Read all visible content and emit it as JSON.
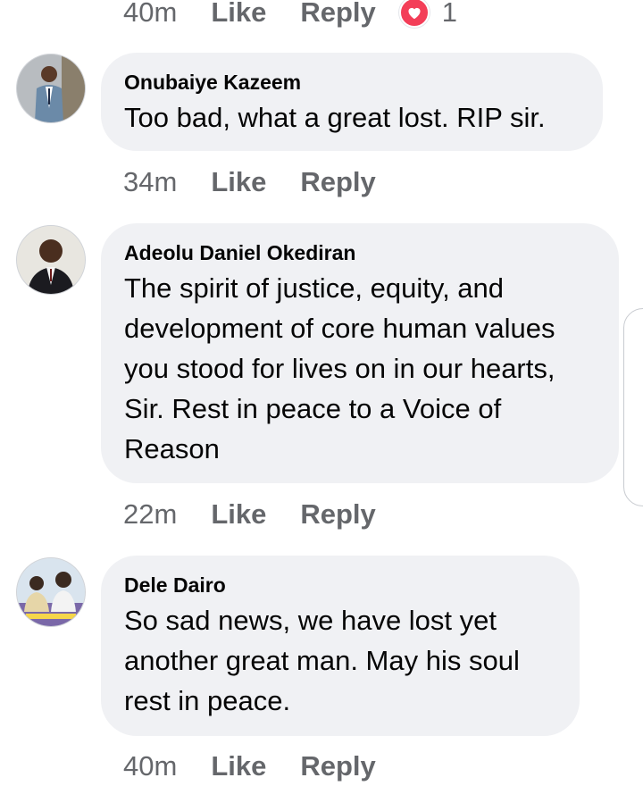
{
  "top_actions": {
    "time": "40m",
    "like_label": "Like",
    "reply_label": "Reply",
    "reaction_count": "1",
    "reaction_icon": "love-icon",
    "reaction_color": "#f33e58"
  },
  "comments": [
    {
      "author": "Onubaiye Kazeem",
      "text": "Too bad, what a great lost. RIP sir.",
      "time": "34m",
      "like_label": "Like",
      "reply_label": "Reply"
    },
    {
      "author": "Adeolu Daniel Okediran",
      "text": "The spirit of justice, equity, and development of core human values you stood for lives on in our hearts, Sir. Rest in peace to a Voice of Reason",
      "time": "22m",
      "like_label": "Like",
      "reply_label": "Reply"
    },
    {
      "author": "Dele Dairo",
      "text": "So sad news, we have lost yet another great man. May his soul rest in peace.",
      "time": "40m",
      "like_label": "Like",
      "reply_label": "Reply"
    }
  ],
  "colors": {
    "bubble_bg": "#f0f1f4",
    "meta_text": "#65676b",
    "body_text": "#050505"
  }
}
